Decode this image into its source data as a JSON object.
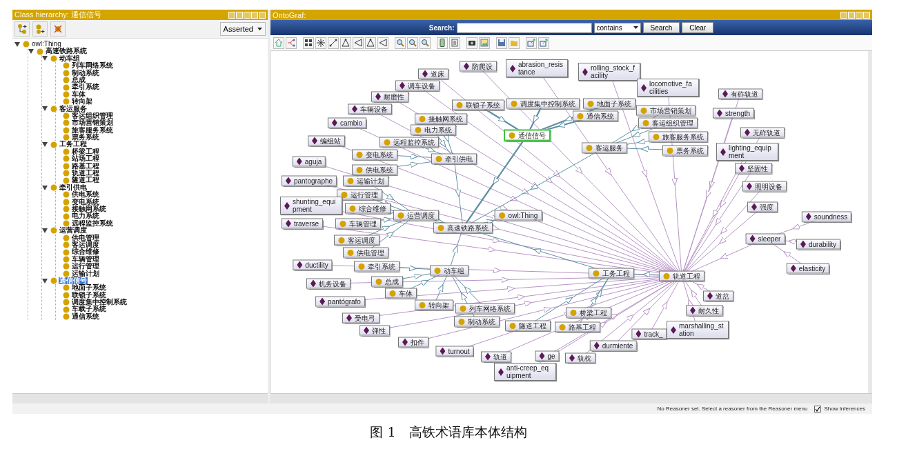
{
  "class_hierarchy": {
    "title": "Class hierarchy: 通信信号",
    "view_select": {
      "value": "Asserted"
    },
    "tree": [
      {
        "label": "owl:Thing",
        "selected": false,
        "expanded": true,
        "children": [
          {
            "label": "高速铁路系统",
            "selected": false,
            "expanded": true,
            "children": [
              {
                "label": "动车组",
                "selected": false,
                "expanded": true,
                "children": [
                  {
                    "label": "列车网络系统",
                    "selected": false
                  },
                  {
                    "label": "制动系统",
                    "selected": false
                  },
                  {
                    "label": "总成",
                    "selected": false
                  },
                  {
                    "label": "牵引系统",
                    "selected": false
                  },
                  {
                    "label": "车体",
                    "selected": false
                  },
                  {
                    "label": "转向架",
                    "selected": false
                  }
                ]
              },
              {
                "label": "客运服务",
                "selected": false,
                "expanded": true,
                "children": [
                  {
                    "label": "客运组织管理",
                    "selected": false
                  },
                  {
                    "label": "市场营销策划",
                    "selected": false
                  },
                  {
                    "label": "旅客服务系统",
                    "selected": false
                  },
                  {
                    "label": "票务系统",
                    "selected": false
                  }
                ]
              },
              {
                "label": "工务工程",
                "selected": false,
                "expanded": true,
                "children": [
                  {
                    "label": "桥梁工程",
                    "selected": false
                  },
                  {
                    "label": "站场工程",
                    "selected": false
                  },
                  {
                    "label": "路基工程",
                    "selected": false
                  },
                  {
                    "label": "轨道工程",
                    "selected": false
                  },
                  {
                    "label": "隧道工程",
                    "selected": false
                  }
                ]
              },
              {
                "label": "牵引供电",
                "selected": false,
                "expanded": true,
                "children": [
                  {
                    "label": "供电系统",
                    "selected": false
                  },
                  {
                    "label": "变电系统",
                    "selected": false
                  },
                  {
                    "label": "接触网系统",
                    "selected": false
                  },
                  {
                    "label": "电力系统",
                    "selected": false
                  },
                  {
                    "label": "远程监控系统",
                    "selected": false
                  }
                ]
              },
              {
                "label": "运营调度",
                "selected": false,
                "expanded": true,
                "children": [
                  {
                    "label": "供电管理",
                    "selected": false
                  },
                  {
                    "label": "客运调度",
                    "selected": false
                  },
                  {
                    "label": "综合维修",
                    "selected": false
                  },
                  {
                    "label": "车辆管理",
                    "selected": false
                  },
                  {
                    "label": "运行管理",
                    "selected": false
                  },
                  {
                    "label": "运输计划",
                    "selected": false
                  }
                ]
              },
              {
                "label": "通信信号",
                "selected": true,
                "expanded": true,
                "children": [
                  {
                    "label": "地面子系统",
                    "selected": false
                  },
                  {
                    "label": "联锁子系统",
                    "selected": false
                  },
                  {
                    "label": "调度集中控制系统",
                    "selected": false
                  },
                  {
                    "label": "车载子系统",
                    "selected": false
                  },
                  {
                    "label": "通信系统",
                    "selected": false
                  }
                ]
              }
            ]
          }
        ]
      }
    ]
  },
  "ontograf": {
    "title": "OntoGraf:",
    "search": {
      "label": "Search:",
      "mode": "contains",
      "buttons": [
        "Search",
        "Clear"
      ]
    },
    "nodes": [
      {
        "label": "道床",
        "kind": "individual",
        "selected": false
      },
      {
        "label": "防爬设",
        "kind": "individual",
        "selected": false
      },
      {
        "label": "abrasion_resistance",
        "kind": "individual",
        "selected": false
      },
      {
        "label": "rolling_stock_facility",
        "kind": "individual",
        "selected": false
      },
      {
        "label": "调车设备",
        "kind": "individual",
        "selected": false
      },
      {
        "label": "locomotive_facilities",
        "kind": "individual",
        "selected": false
      },
      {
        "label": "耐磨性",
        "kind": "individual",
        "selected": false
      },
      {
        "label": "有砟轨道",
        "kind": "individual",
        "selected": false
      },
      {
        "label": "车辆设备",
        "kind": "individual",
        "selected": false
      },
      {
        "label": "联锁子系统",
        "kind": "class",
        "selected": false
      },
      {
        "label": "调度集中控制系统",
        "kind": "class",
        "selected": false
      },
      {
        "label": "地面子系统",
        "kind": "class",
        "selected": false
      },
      {
        "label": "市场营销策划",
        "kind": "class",
        "selected": false
      },
      {
        "label": "接触网系统",
        "kind": "class",
        "selected": false
      },
      {
        "label": "通信系统",
        "kind": "class",
        "selected": false
      },
      {
        "label": "strength",
        "kind": "individual",
        "selected": false
      },
      {
        "label": "cambio",
        "kind": "individual",
        "selected": false
      },
      {
        "label": "电力系统",
        "kind": "class",
        "selected": false
      },
      {
        "label": "客运组织管理",
        "kind": "class",
        "selected": false
      },
      {
        "label": "编组站",
        "kind": "individual",
        "selected": false
      },
      {
        "label": "远程监控系统",
        "kind": "class",
        "selected": false
      },
      {
        "label": "通信信号",
        "kind": "class",
        "selected": true
      },
      {
        "label": "旅客服务系统",
        "kind": "class",
        "selected": false
      },
      {
        "label": "无砟轨道",
        "kind": "individual",
        "selected": false
      },
      {
        "label": "变电系统",
        "kind": "class",
        "selected": false
      },
      {
        "label": "客运服务",
        "kind": "class",
        "selected": false
      },
      {
        "label": "票务系统",
        "kind": "class",
        "selected": false
      },
      {
        "label": "lighting_equipment",
        "kind": "individual",
        "selected": false
      },
      {
        "label": "aguja",
        "kind": "individual",
        "selected": false
      },
      {
        "label": "牵引供电",
        "kind": "class",
        "selected": false
      },
      {
        "label": "供电系统",
        "kind": "class",
        "selected": false
      },
      {
        "label": "坚固性",
        "kind": "individual",
        "selected": false
      },
      {
        "label": "pantographe",
        "kind": "individual",
        "selected": false
      },
      {
        "label": "运输计划",
        "kind": "class",
        "selected": false
      },
      {
        "label": "照明设备",
        "kind": "individual",
        "selected": false
      },
      {
        "label": "运行管理",
        "kind": "class",
        "selected": false
      },
      {
        "label": "shunting_equipment",
        "kind": "individual",
        "selected": false
      },
      {
        "label": "综合维修",
        "kind": "class",
        "selected": false
      },
      {
        "label": "强度",
        "kind": "individual",
        "selected": false
      },
      {
        "label": "traverse",
        "kind": "individual",
        "selected": false
      },
      {
        "label": "车辆管理",
        "kind": "class",
        "selected": false
      },
      {
        "label": "运营调度",
        "kind": "class",
        "selected": false
      },
      {
        "label": "owl:Thing",
        "kind": "class",
        "selected": false
      },
      {
        "label": "soundness",
        "kind": "individual",
        "selected": false
      },
      {
        "label": "高速铁路系统",
        "kind": "class",
        "selected": false
      },
      {
        "label": "客运调度",
        "kind": "class",
        "selected": false
      },
      {
        "label": "sleeper",
        "kind": "individual",
        "selected": false
      },
      {
        "label": "durability",
        "kind": "individual",
        "selected": false
      },
      {
        "label": "供电管理",
        "kind": "class",
        "selected": false
      },
      {
        "label": "ductility",
        "kind": "individual",
        "selected": false
      },
      {
        "label": "牵引系统",
        "kind": "class",
        "selected": false
      },
      {
        "label": "动车组",
        "kind": "class",
        "selected": false
      },
      {
        "label": "机务设备",
        "kind": "individual",
        "selected": false
      },
      {
        "label": "总成",
        "kind": "class",
        "selected": false
      },
      {
        "label": "工务工程",
        "kind": "class",
        "selected": false
      },
      {
        "label": "轨道工程",
        "kind": "class",
        "selected": false
      },
      {
        "label": "elasticity",
        "kind": "individual",
        "selected": false
      },
      {
        "label": "车体",
        "kind": "class",
        "selected": false
      },
      {
        "label": "道岔",
        "kind": "individual",
        "selected": false
      },
      {
        "label": "pantógrafo",
        "kind": "individual",
        "selected": false
      },
      {
        "label": "转向架",
        "kind": "class",
        "selected": false
      },
      {
        "label": "受电弓",
        "kind": "individual",
        "selected": false
      },
      {
        "label": "列车网络系统",
        "kind": "class",
        "selected": false
      },
      {
        "label": "桥梁工程",
        "kind": "class",
        "selected": false
      },
      {
        "label": "耐久性",
        "kind": "individual",
        "selected": false
      },
      {
        "label": "弹性",
        "kind": "individual",
        "selected": false
      },
      {
        "label": "制动系统",
        "kind": "class",
        "selected": false
      },
      {
        "label": "隧道工程",
        "kind": "class",
        "selected": false
      },
      {
        "label": "路基工程",
        "kind": "class",
        "selected": false
      },
      {
        "label": "track_",
        "kind": "individual",
        "selected": false
      },
      {
        "label": "marshalling_station",
        "kind": "individual",
        "selected": false
      },
      {
        "label": "扣件",
        "kind": "individual",
        "selected": false
      },
      {
        "label": "turnout",
        "kind": "individual",
        "selected": false
      },
      {
        "label": "durmiente",
        "kind": "individual",
        "selected": false
      },
      {
        "label": "轨道",
        "kind": "individual",
        "selected": false
      },
      {
        "label": "ge",
        "kind": "individual",
        "selected": false
      },
      {
        "label": "轨枕",
        "kind": "individual",
        "selected": false
      },
      {
        "label": "anti-creep_equipment",
        "kind": "individual",
        "selected": false
      }
    ]
  },
  "status_bar": {
    "message": "No Reasoner set. Select a reasoner from the Reasoner menu",
    "show_inferences": {
      "label": "Show Inferences",
      "checked": true
    }
  },
  "caption": "图 1　高铁术语库本体结构"
}
